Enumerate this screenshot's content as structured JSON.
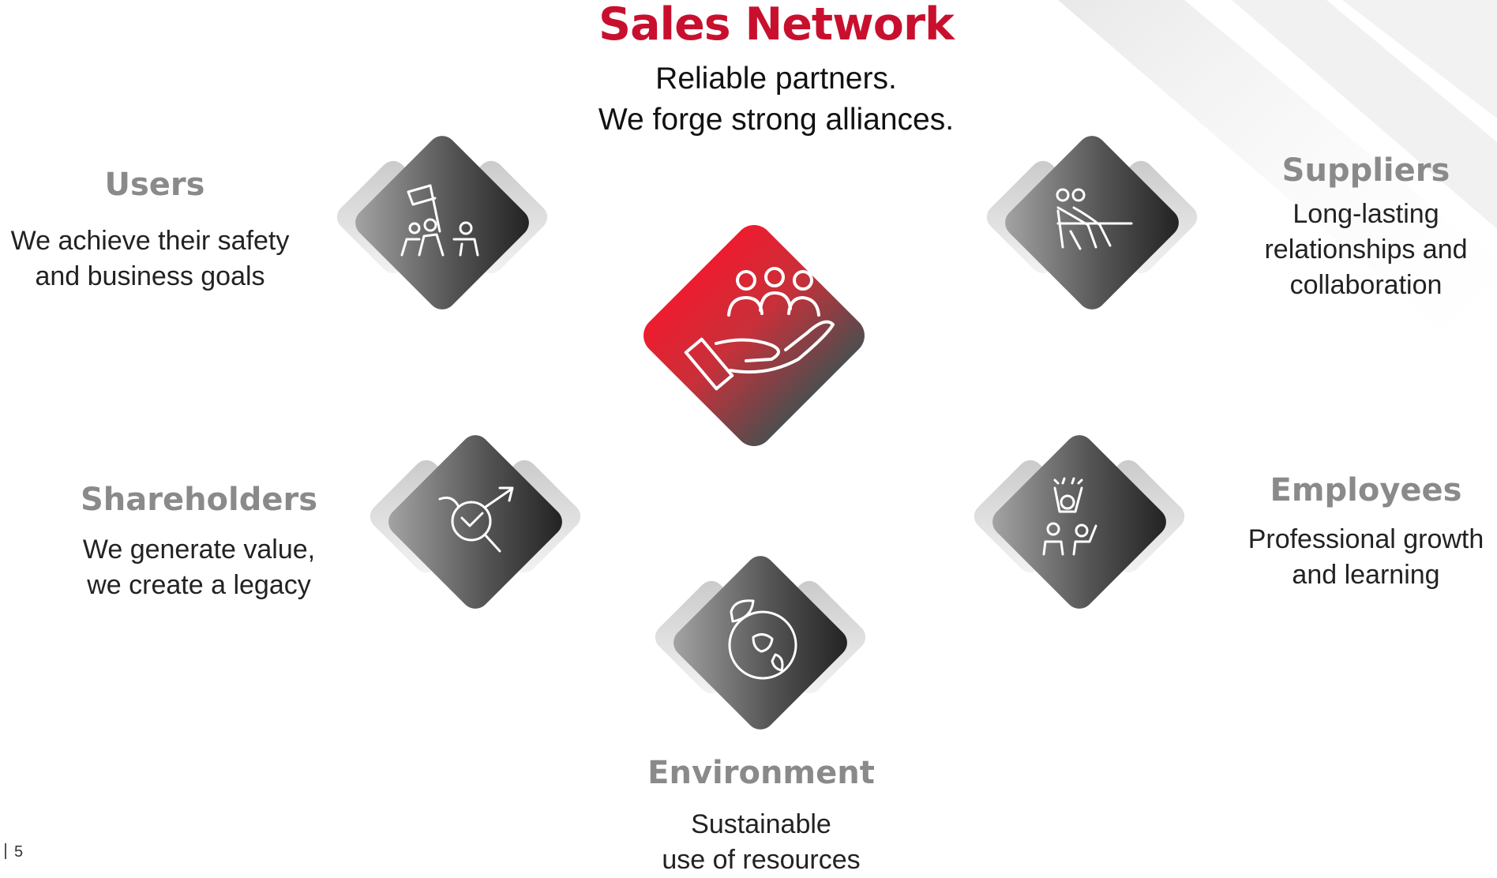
{
  "header": {
    "title": "Sales Network",
    "subtitle_lines": [
      "Reliable partners.",
      "We forge strong alliances."
    ]
  },
  "nodes": {
    "users": {
      "title": "Users",
      "desc": [
        "We achieve their safety",
        "and business goals"
      ],
      "icon": "team-flag-icon"
    },
    "suppliers": {
      "title": "Suppliers",
      "desc": [
        "Long-lasting",
        "relationships and",
        "collaboration"
      ],
      "icon": "tug-of-war-icon"
    },
    "shareholders": {
      "title": "Shareholders",
      "desc": [
        "We generate value,",
        "we create a legacy"
      ],
      "icon": "growth-analysis-icon"
    },
    "employees": {
      "title": "Employees",
      "desc": [
        "Professional growth",
        "and learning"
      ],
      "icon": "celebrating-team-icon"
    },
    "environment": {
      "title": "Environment",
      "desc": [
        "Sustainable",
        "use of resources"
      ],
      "icon": "globe-leaf-icon"
    },
    "center": {
      "icon": "hand-holding-people-icon"
    }
  },
  "footer": {
    "page_number": "5"
  },
  "colors": {
    "accent": "#c8102e",
    "heading_gray": "#8a8a8a",
    "tile_dark": "#2e2e2e",
    "tile_light": "#9a9a9a"
  }
}
